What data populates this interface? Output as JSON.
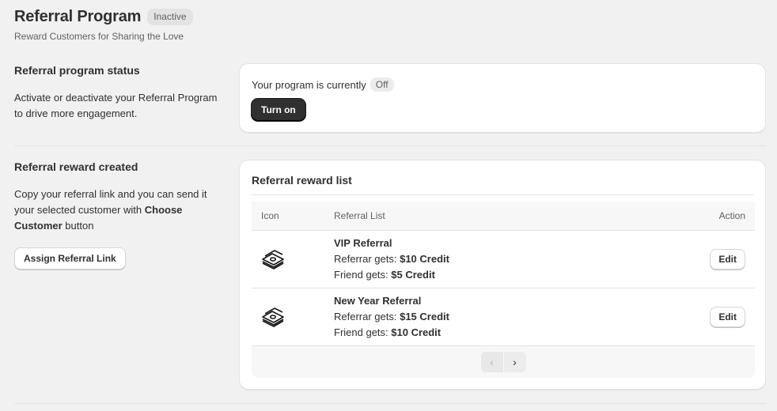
{
  "header": {
    "title": "Referral Program",
    "status_badge": "Inactive",
    "subtitle": "Reward Customers for Sharing the Love"
  },
  "status_section": {
    "title": "Referral program status",
    "description": "Activate or deactivate your Referral Program to drive more engagement.",
    "status_text": "Your program is currently",
    "status_value": "Off",
    "toggle_button": "Turn on"
  },
  "reward_section": {
    "title": "Referral reward created",
    "description_prefix": "Copy your referral link and you can send it your selected customer with ",
    "description_bold": "Choose Customer",
    "description_suffix": " button",
    "assign_button": "Assign Referral Link"
  },
  "reward_list": {
    "title": "Referral reward list",
    "columns": [
      "Icon",
      "Referral List",
      "Action"
    ],
    "rows": [
      {
        "icon": "money-stack-icon",
        "name": "VIP Referral",
        "referrer_label": "Referrar gets: ",
        "referrer_value": "$10 Credit",
        "friend_label": "Friend gets: ",
        "friend_value": "$5 Credit",
        "action": "Edit"
      },
      {
        "icon": "money-stack-icon",
        "name": "New Year Referral",
        "referrer_label": "Referrar gets: ",
        "referrer_value": "$15 Credit",
        "friend_label": "Friend gets: ",
        "friend_value": "$10 Credit",
        "action": "Edit"
      }
    ],
    "pagination": {
      "prev": "‹",
      "next": "›"
    }
  }
}
